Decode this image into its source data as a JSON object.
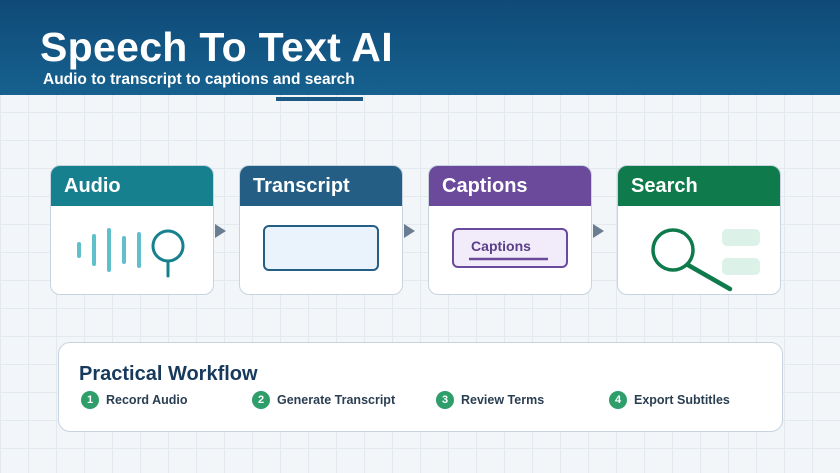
{
  "header": {
    "title": "Speech To Text AI",
    "subtitle": "Audio to transcript to captions and search"
  },
  "stages": [
    {
      "label": "Audio",
      "color": "#17808f",
      "icon": "waveform-magnifier-icon"
    },
    {
      "label": "Transcript",
      "color": "#245e85",
      "icon": "text-box-icon"
    },
    {
      "label": "Captions",
      "color": "#6b4a9c",
      "icon": "caption-box-icon",
      "caption_text": "Captions"
    },
    {
      "label": "Search",
      "color": "#0f7a4b",
      "icon": "search-icon"
    }
  ],
  "workflow": {
    "title": "Practical Workflow",
    "steps": [
      {
        "num": "1",
        "label": "Record Audio"
      },
      {
        "num": "2",
        "label": "Generate Transcript"
      },
      {
        "num": "3",
        "label": "Review Terms"
      },
      {
        "num": "4",
        "label": "Export Subtitles"
      }
    ]
  }
}
